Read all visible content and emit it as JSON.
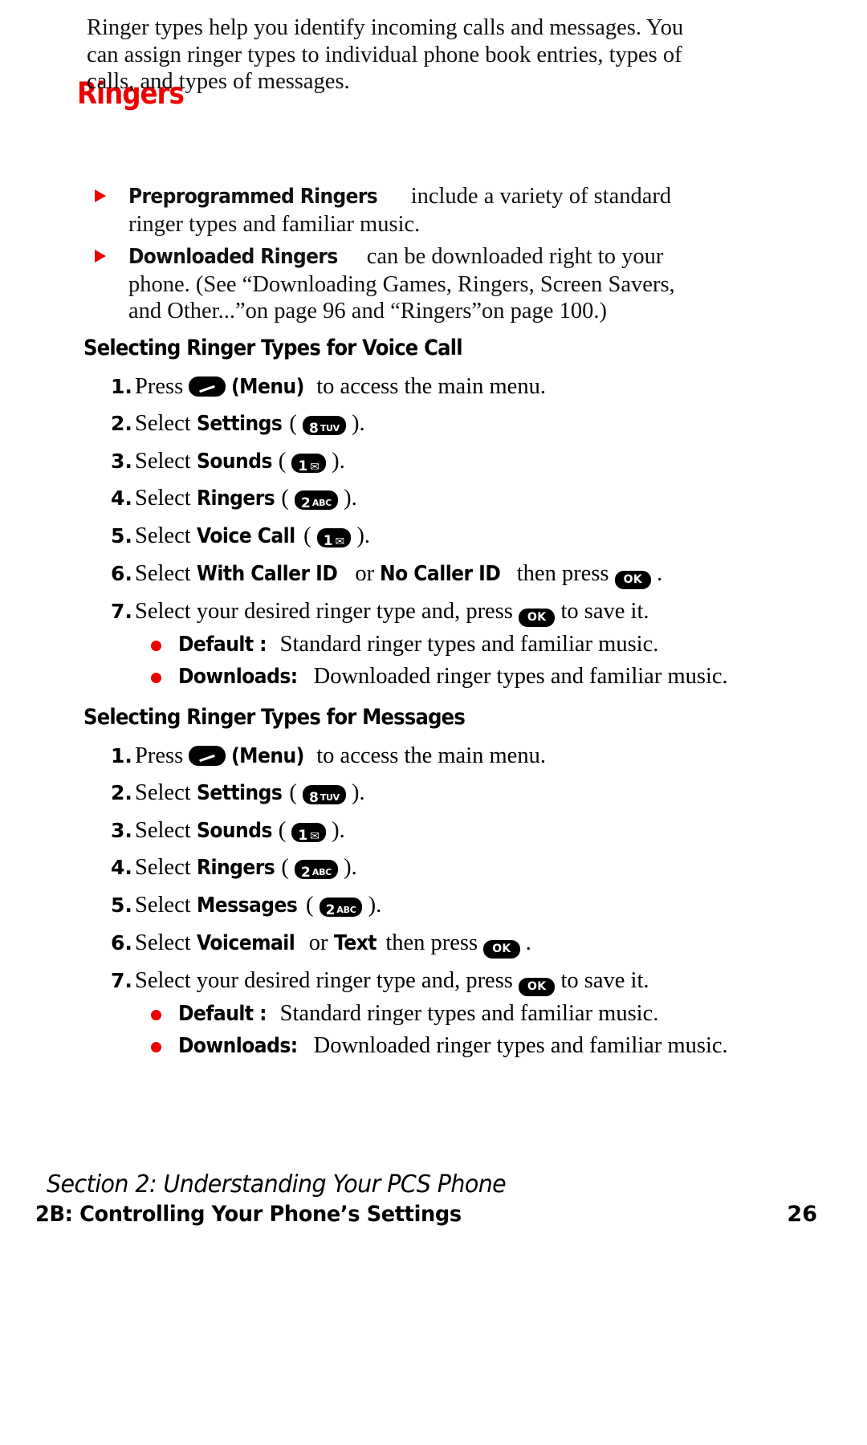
{
  "title": "Ringers",
  "title_color": "#ee0000",
  "bullet_color": "#ee0000",
  "intro": "Ringer types help you identify incoming calls and messages. You can assign ringer types to individual phone book entries, types of calls, and types of messages.",
  "arrow_bullets": [
    {
      "lead": "Preprogrammed Ringers",
      "rest": " include a variety of standard ringer types and familiar music."
    },
    {
      "lead": "Downloaded Ringers",
      "rest": " can be downloaded right to your phone. (See “Downloading Games, Ringers, Screen Savers, and Other...”on page 96 and “Ringers”on page 100.)"
    }
  ],
  "sections": [
    {
      "heading": "Selecting Ringer Types for Voice Call",
      "steps": [
        {
          "num": "1.",
          "pre": "Press ",
          "key": "menu",
          "post_bold": "(Menu)",
          "post": " to access the main menu."
        },
        {
          "num": "2.",
          "pre": "Select ",
          "bold": "Settings",
          "paren_open": "(",
          "key": "8tuv",
          "key_digit": "8",
          "key_sub": "TUV",
          "paren_close": ").",
          "post": ""
        },
        {
          "num": "3.",
          "pre": "Select ",
          "bold": "Sounds",
          "paren_open": "(",
          "key": "1mail",
          "key_digit": "1",
          "key_sub": "✉",
          "paren_close": ").",
          "post": ""
        },
        {
          "num": "4.",
          "pre": "Select ",
          "bold": "Ringers",
          "paren_open": "(",
          "key": "2abc",
          "key_digit": "2",
          "key_sub": "ABC",
          "paren_close": ").",
          "post": ""
        },
        {
          "num": "5.",
          "pre": "Select ",
          "bold": "Voice Call",
          "paren_open": "(",
          "key": "1mail",
          "key_digit": "1",
          "key_sub": "✉",
          "paren_close": ").",
          "post": ""
        },
        {
          "num": "6.",
          "pre": "Select ",
          "bold": "With Caller ID",
          "mid": " or ",
          "bold2": "No Caller ID",
          "pre_key": " then press ",
          "key": "ok",
          "post": " ."
        },
        {
          "num": "7.",
          "pre": "Select your desired ringer type and, press ",
          "key": "ok",
          "post": " to save it."
        }
      ],
      "dot_bullets": [
        {
          "lead": "Default :",
          "rest": " Standard ringer types and familiar music."
        },
        {
          "lead": "Downloads:",
          "rest": " Downloaded ringer types and familiar music."
        }
      ]
    },
    {
      "heading": "Selecting Ringer Types for Messages",
      "steps": [
        {
          "num": "1.",
          "pre": "Press ",
          "key": "menu",
          "post_bold": "(Menu)",
          "post": " to access the main menu."
        },
        {
          "num": "2.",
          "pre": "Select ",
          "bold": "Settings",
          "paren_open": "(",
          "key": "8tuv",
          "key_digit": "8",
          "key_sub": "TUV",
          "paren_close": ").",
          "post": ""
        },
        {
          "num": "3.",
          "pre": "Select ",
          "bold": "Sounds",
          "paren_open": "(",
          "key": "1mail",
          "key_digit": "1",
          "key_sub": "✉",
          "paren_close": ").",
          "post": ""
        },
        {
          "num": "4.",
          "pre": "Select ",
          "bold": "Ringers",
          "paren_open": "(",
          "key": "2abc",
          "key_digit": "2",
          "key_sub": "ABC",
          "paren_close": ").",
          "post": ""
        },
        {
          "num": "5.",
          "pre": "Select ",
          "bold": "Messages",
          "paren_open": "(",
          "key": "2abc",
          "key_digit": "2",
          "key_sub": "ABC",
          "paren_close": ").",
          "post": ""
        },
        {
          "num": "6.",
          "pre": "Select ",
          "bold": "Voicemail",
          "mid": " or ",
          "bold2": "Text",
          "pre_key": " then press ",
          "key": "ok",
          "post": " ."
        },
        {
          "num": "7.",
          "pre": "Select your desired ringer type and, press ",
          "key": "ok",
          "post": " to save it."
        }
      ],
      "dot_bullets": [
        {
          "lead": "Default :",
          "rest": " Standard ringer types and familiar music."
        },
        {
          "lead": "Downloads:",
          "rest": " Downloaded ringer types and familiar music."
        }
      ]
    }
  ],
  "footer": {
    "line1": "Section 2: Understanding Your PCS Phone",
    "line2": "2B: Controlling Your Phone’s Settings",
    "page_number": "26"
  }
}
